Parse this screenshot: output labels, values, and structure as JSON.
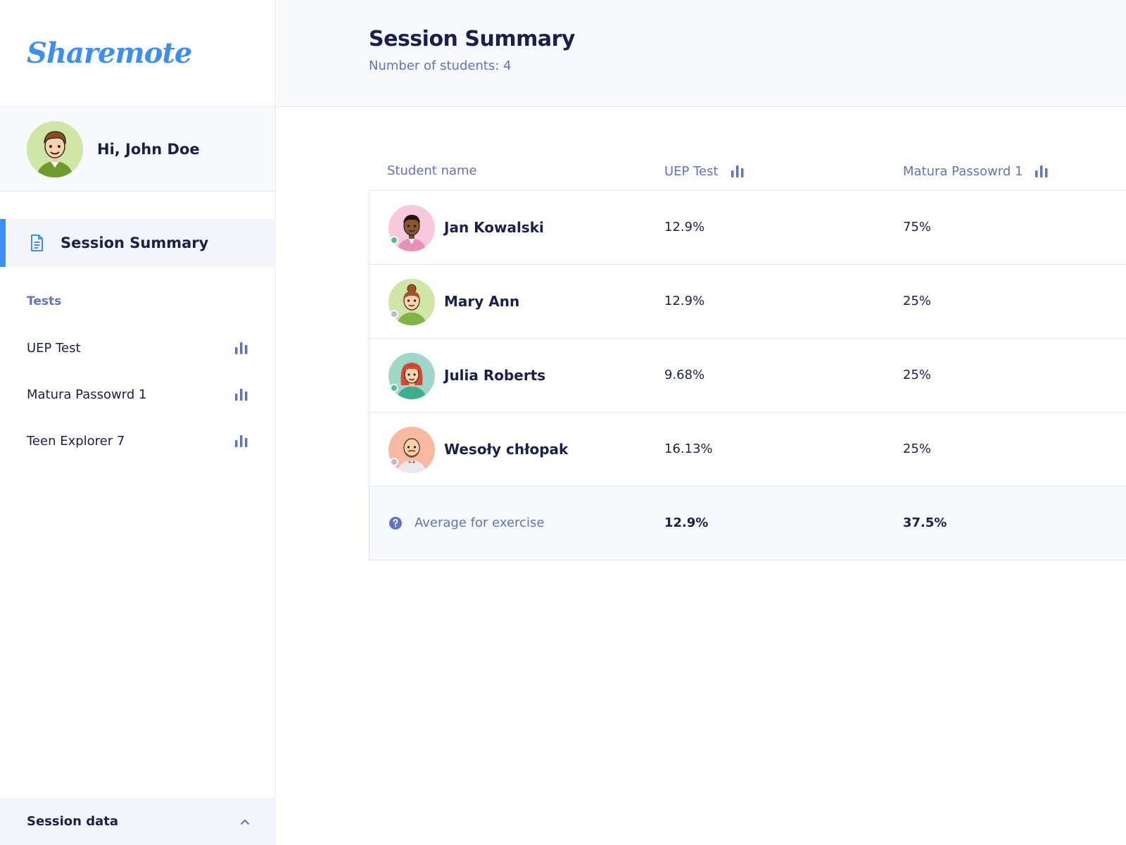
{
  "app": {
    "logo": "Sharemote"
  },
  "user": {
    "greeting": "Hi, John Doe"
  },
  "nav": {
    "active_label": "Session Summary"
  },
  "tests": {
    "heading": "Tests",
    "items": [
      {
        "label": "UEP Test",
        "icon": "bar-chart-icon"
      },
      {
        "label": "Matura Passowrd 1",
        "icon": "bar-chart-icon"
      },
      {
        "label": "Teen Explorer 7",
        "icon": "bar-chart-icon"
      }
    ]
  },
  "footer": {
    "session_data_label": "Session data",
    "icon": "chevron-up-icon"
  },
  "header": {
    "title": "Session Summary",
    "subtitle": "Number of students: 4"
  },
  "table": {
    "columns": [
      "Student name",
      "UEP Test",
      "Matura Passowrd 1"
    ],
    "rows": [
      {
        "name": "Jan Kowalski",
        "uep": "12.9%",
        "matura": "75%",
        "online": true,
        "avatar_bg": "#f8c8dc"
      },
      {
        "name": "Mary Ann",
        "uep": "12.9%",
        "matura": "25%",
        "online": false,
        "avatar_bg": "#cfe6a6"
      },
      {
        "name": "Julia Roberts",
        "uep": "9.68%",
        "matura": "25%",
        "online": true,
        "avatar_bg": "#9fd8c8"
      },
      {
        "name": "Wesoły chłopak",
        "uep": "16.13%",
        "matura": "25%",
        "online": false,
        "avatar_bg": "#f7b9a2"
      }
    ],
    "average": {
      "label": "Average for exercise",
      "uep": "12.9%",
      "matura": "37.5%"
    }
  },
  "colors": {
    "accent": "#3b8ff0",
    "muted": "#5f73c6",
    "text": "#1b1f4b",
    "online": "#4cc47a",
    "offline": "#b8bcc8"
  }
}
